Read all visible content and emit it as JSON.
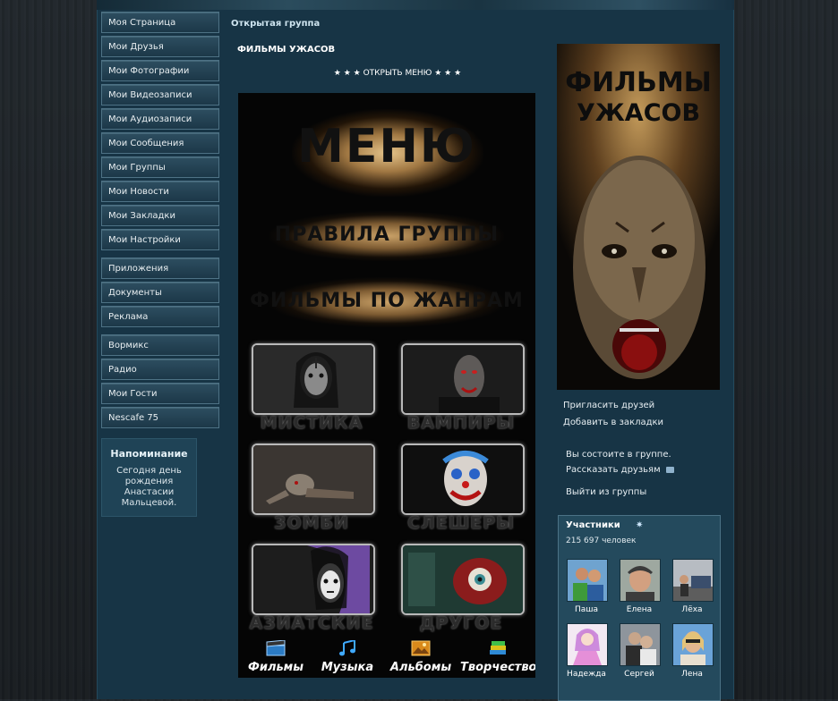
{
  "sidebar": {
    "groups": [
      [
        "Моя Страница",
        "Мои Друзья",
        "Мои Фотографии",
        "Мои Видеозаписи",
        "Мои Аудиозаписи",
        "Мои Сообщения",
        "Мои Группы",
        "Мои Новости",
        "Мои Закладки",
        "Мои Настройки"
      ],
      [
        "Приложения",
        "Документы",
        "Реклама"
      ],
      [
        "Вормикс",
        "Радио",
        "Мои Гости",
        "Nescafe 75"
      ]
    ]
  },
  "reminder": {
    "title": "Напоминание",
    "text": "Сегодня день рождения Анастасии Мальцевой."
  },
  "group": {
    "type": "Открытая группа",
    "name": "ФИЛЬМЫ УЖАСОВ",
    "open_menu": "★ ★ ★ ОТКРЫТЬ МЕНЮ ★ ★ ★"
  },
  "poster": {
    "title": "МЕНЮ",
    "rules": "ПРАВИЛА ГРУППЫ",
    "genres": "ФИЛЬМЫ ПО ЖАНРАМ",
    "tiles": [
      "МИСТИКА",
      "ВАМПИРЫ",
      "ЗОМБИ",
      "СЛЕШЕРЫ",
      "АЗИАТСКИЕ",
      "ДРУГОЕ"
    ],
    "nav": [
      "Фильмы",
      "Музыка",
      "Альбомы",
      "Творчество"
    ]
  },
  "cover": {
    "line1": "ФИЛЬМЫ",
    "line2": "УЖАСОВ"
  },
  "actions": {
    "invite": "Пригласить друзей",
    "bookmark": "Добавить в закладки",
    "member_status": "Вы состоите в группе.",
    "tell_friends": "Рассказать друзьям",
    "leave": "Выйти из группы"
  },
  "members": {
    "title": "Участники",
    "count": "215 697 человек",
    "people": [
      "Паша",
      "Елена",
      "Лёха",
      "Надежда",
      "Сергей",
      "Лена"
    ]
  },
  "colors": {
    "panel": "#173445",
    "menu_border": "#4e7285",
    "text_link": "#e7eef2"
  }
}
